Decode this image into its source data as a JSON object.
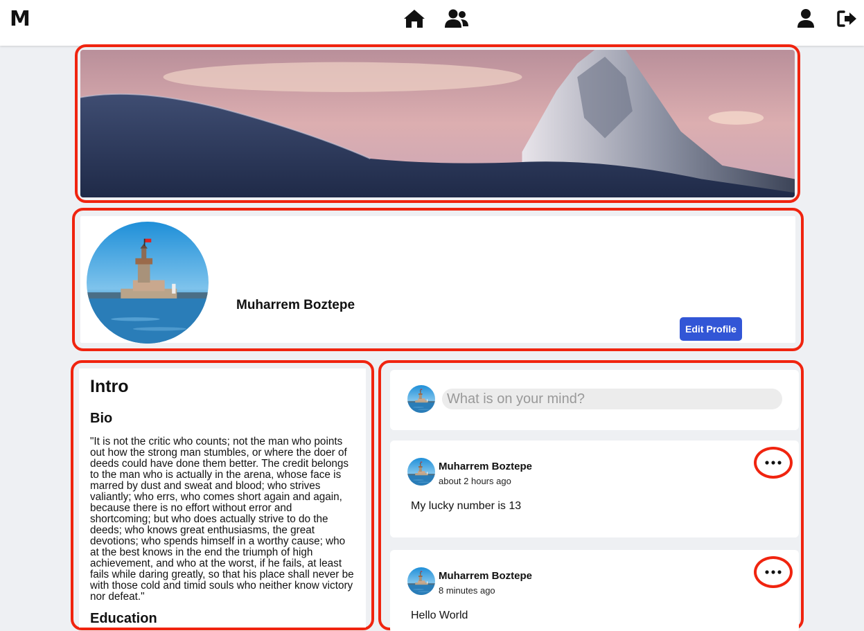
{
  "nav": {
    "logo": "M",
    "icons": [
      "home-icon",
      "friends-icon",
      "profile-icon",
      "logout-icon"
    ]
  },
  "profile": {
    "name": "Muharrem Boztepe",
    "edit_button": "Edit Profile"
  },
  "intro": {
    "title": "Intro",
    "bio_heading": "Bio",
    "bio_text": "\"It is not the critic who counts; not the man who points out how the strong man stumbles, or where the doer of deeds could have done them better. The credit belongs to the man who is actually in the arena, whose face is marred by dust and sweat and blood; who strives valiantly; who errs, who comes short again and again, because there is no effort without error and shortcoming; but who does actually strive to do the deeds; who knows great enthusiasms, the great devotions; who spends himself in a worthy cause; who at the best knows in the end the triumph of high achievement, and who at the worst, if he fails, at least fails while daring greatly, so that his place shall never be with those cold and timid souls who neither know victory nor defeat.\"",
    "education_heading": "Education"
  },
  "composer": {
    "placeholder": "What is on your mind?"
  },
  "posts": [
    {
      "author": "Muharrem Boztepe",
      "time": "about 2 hours ago",
      "text": "My lucky number is 13"
    },
    {
      "author": "Muharrem Boztepe",
      "time": "8 minutes ago",
      "text": "Hello World"
    }
  ],
  "colors": {
    "accent": "#3256d6",
    "annotation": "#f0240f",
    "background": "#eef0f3"
  }
}
